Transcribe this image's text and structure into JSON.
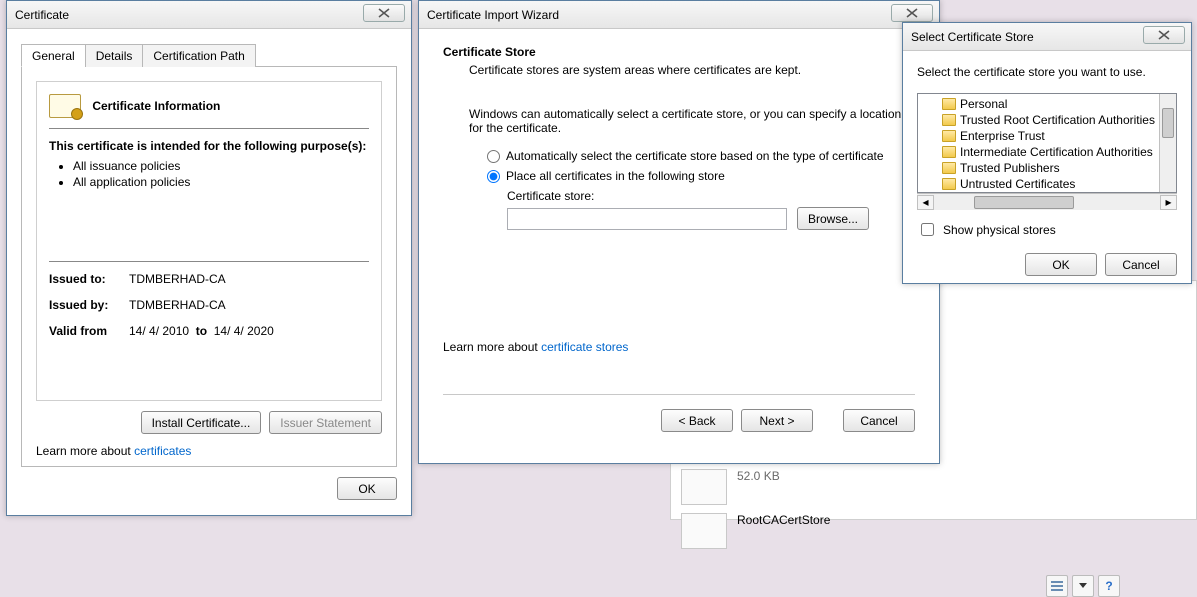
{
  "cert_dialog": {
    "title": "Certificate",
    "tabs": {
      "general": "General",
      "details": "Details",
      "path": "Certification Path"
    },
    "info_heading": "Certificate Information",
    "purpose_heading": "This certificate is intended for the following purpose(s):",
    "purposes": [
      "All issuance policies",
      "All application policies"
    ],
    "issued_to_label": "Issued to:",
    "issued_to_value": "TDMBERHAD-CA",
    "issued_by_label": "Issued by:",
    "issued_by_value": "TDMBERHAD-CA",
    "valid_from_label": "Valid from",
    "valid_from_value": "14/ 4/ 2010",
    "valid_to_label": "to",
    "valid_to_value": "14/ 4/ 2020",
    "install_btn": "Install Certificate...",
    "issuer_btn": "Issuer Statement",
    "learn_more_prefix": "Learn more about ",
    "learn_more_link": "certificates",
    "ok_btn": "OK"
  },
  "wizard": {
    "title": "Certificate Import Wizard",
    "section_title": "Certificate Store",
    "section_desc": "Certificate stores are system areas where certificates are kept.",
    "explain": "Windows can automatically select a certificate store, or you can specify a location for the certificate.",
    "radio_auto": "Automatically select the certificate store based on the type of certificate",
    "radio_place": "Place all certificates in the following store",
    "store_label": "Certificate store:",
    "browse_btn": "Browse...",
    "learn_more_prefix": "Learn more about ",
    "learn_more_link": "certificate stores",
    "back_btn": "< Back",
    "next_btn": "Next >",
    "cancel_btn": "Cancel"
  },
  "select_store": {
    "title": "Select Certificate Store",
    "instruction": "Select the certificate store you want to use.",
    "items": [
      "Personal",
      "Trusted Root Certification Authorities",
      "Enterprise Trust",
      "Intermediate Certification Authorities",
      "Trusted Publishers",
      "Untrusted Certificates"
    ],
    "show_physical": "Show physical stores",
    "ok_btn": "OK",
    "cancel_btn": "Cancel"
  },
  "explorer": {
    "file_size": "52.0 KB",
    "file_name": "RootCACertStore"
  }
}
